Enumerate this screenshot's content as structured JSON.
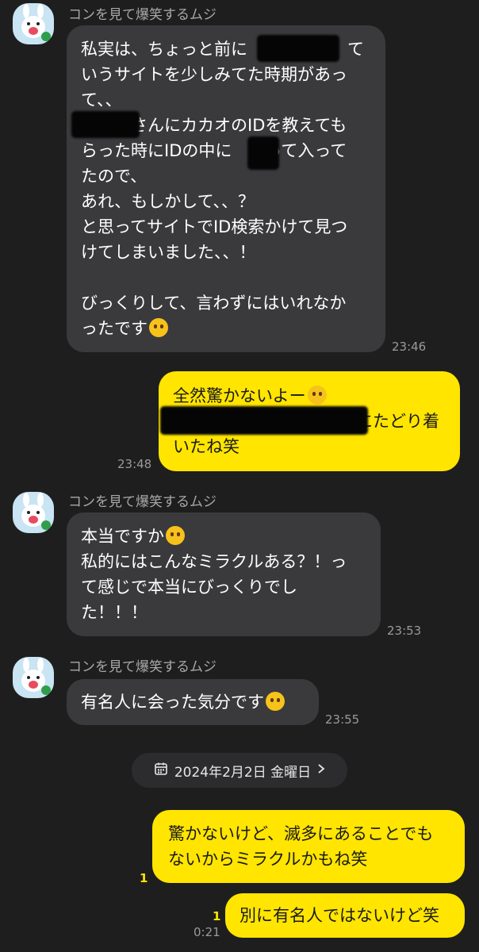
{
  "sender_name": "コンを見て爆笑するムジ",
  "messages": [
    {
      "id": "m1",
      "lines": [
        "私実は、ちょっと前に　　　　　　て",
        "いうサイトを少しみてた時期があっ",
        "て、、",
        "　　　さんにカカオのIDを教えても",
        "らった時にIDの中に　　って入って",
        "たので、",
        "あれ、もしかして、、？",
        "と思ってサイトでID検索かけて見つ",
        "けてしまいました、、！",
        "",
        "びっくりして、言わずにはいれなか",
        "ったです"
      ],
      "time": "23:46",
      "emoji": "face-with-open-eyes-and-hand-over-mouth"
    },
    {
      "id": "m2",
      "lines": [
        "全然驚かないよー",
        "　　　　　　　　　　　にたどり着",
        "いたね笑"
      ],
      "time": "23:48",
      "emoji": "kissing-face"
    },
    {
      "id": "m3",
      "lines": [
        "本当ですか",
        "私的にはこんなミラクルある？！っ",
        "て感じで本当にびっくりでし",
        "た！！！"
      ],
      "time": "23:53",
      "emoji": "face-with-tears-of-joy"
    },
    {
      "id": "m4",
      "lines": [
        "有名人に会った気分です"
      ],
      "time": "23:55",
      "emoji": "face-with-tears-of-joy"
    },
    {
      "id": "m5",
      "lines": [
        "驚かないけど、滅多にあることでも",
        "ないからミラクルかもね笑"
      ],
      "unread": "1"
    },
    {
      "id": "m6",
      "lines": [
        "別に有名人ではないけど笑"
      ],
      "unread": "1",
      "time": "0:21"
    }
  ],
  "date_divider": {
    "label": "2024年2月2日 金曜日",
    "icon": "calendar-icon",
    "chevron": "chevron-right-icon"
  },
  "colors": {
    "background": "#1e1e1e",
    "incoming_bubble": "#3a3a3c",
    "outgoing_bubble": "#ffe500",
    "unread_count": "#ffe500"
  }
}
